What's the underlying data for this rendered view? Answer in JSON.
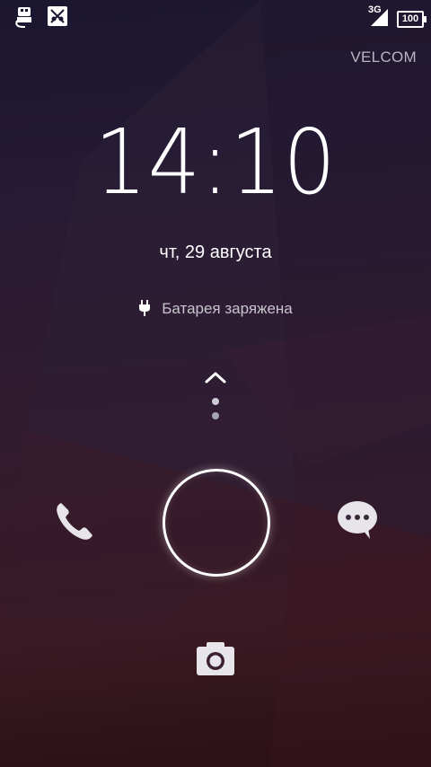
{
  "status_bar": {
    "left_icons": [
      "usb-debugging-icon",
      "usb-connection-icon"
    ],
    "network_type": "3G",
    "battery_level": "100",
    "right_icons": [
      "signal-strength-icon",
      "battery-icon"
    ]
  },
  "lockscreen": {
    "carrier": "VELCOM",
    "time": "14:10",
    "date": "чт, 29 августа",
    "battery_status": "Батарея заряжена",
    "targets": {
      "up": "chevron-up-icon",
      "left": "phone-icon",
      "right": "messaging-icon",
      "down": "camera-icon"
    }
  },
  "colors": {
    "background_top": "#1b1630",
    "background_bottom": "#2b1015",
    "text_secondary": "#b9b6c2",
    "ring": "#ffffff"
  }
}
